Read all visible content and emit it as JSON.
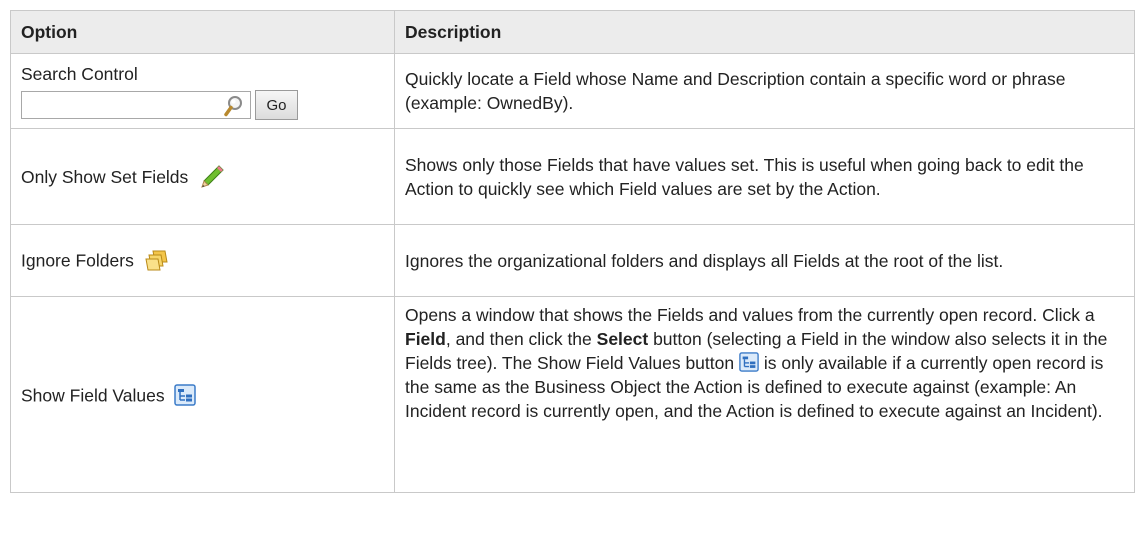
{
  "table": {
    "headers": {
      "option": "Option",
      "description": "Description"
    },
    "search_row": {
      "option_label": "Search Control",
      "search_input_value": "",
      "go_label": "Go",
      "description": "Quickly locate a Field whose Name and Description contain a specific word or phrase (example: OwnedBy)."
    },
    "set_fields_row": {
      "option_label": "Only Show Set Fields",
      "icon": "pencil-icon",
      "description": "Shows only those Fields that have values set. This is useful when going back to edit the Action to quickly see which Field values are set by the Action."
    },
    "folders_row": {
      "option_label": "Ignore Folders",
      "icon": "folders-icon",
      "description": "Ignores the organizational folders and displays all Fields at the root of the list."
    },
    "field_values_row": {
      "option_label": "Show Field Values",
      "icon": "field-values-icon",
      "desc_part1": "Opens a window that shows the Fields and values from the currently open record. Click a ",
      "desc_bold1": "Field",
      "desc_part2": ", and then click the ",
      "desc_bold2": "Select",
      "desc_part3": " button (selecting a Field in the window also selects it in the Fields tree). The Show Field Values button ",
      "desc_part4": " is only available if a currently open record is the same as the Business Object the Action is defined to execute against (example: An Incident record is currently open, and the Action is defined to execute against an Incident)."
    }
  }
}
